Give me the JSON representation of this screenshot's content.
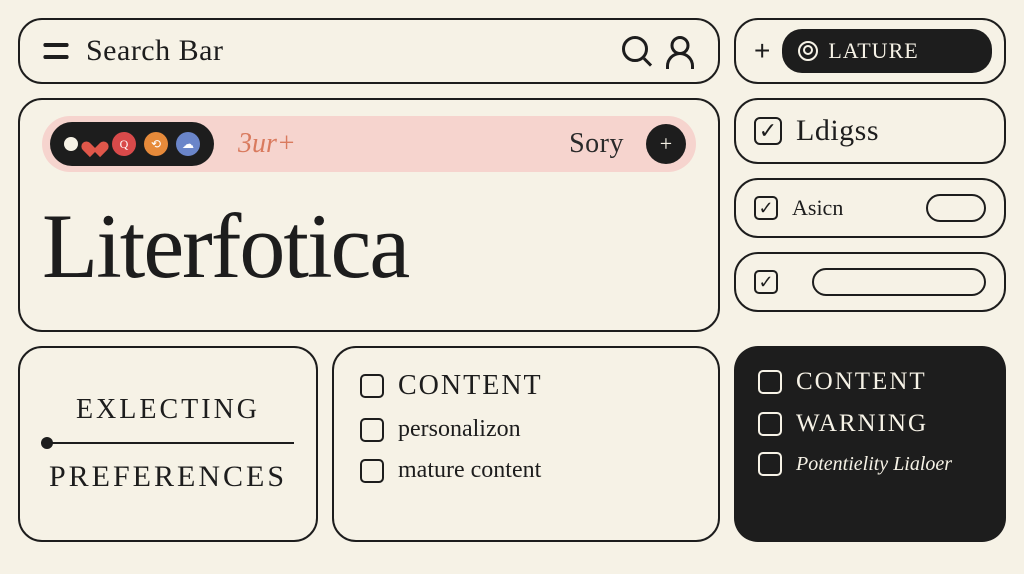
{
  "search": {
    "placeholder": "Search Bar"
  },
  "topRight": {
    "plus": "+",
    "pill": "LATURE"
  },
  "hero": {
    "tabLabel1": "3ur+",
    "tabLabel2": "Sory",
    "title": "Literfotica"
  },
  "right": {
    "ldigss": "Ldigss",
    "asicn": "Asicn",
    "blank": ""
  },
  "prefs": {
    "line1": "EXLECTING",
    "line2": "PREFERENCES"
  },
  "content": {
    "heading": "CONTENT",
    "item1": "personalizon",
    "item2": "mature content"
  },
  "warn": {
    "line1": "CONTENT",
    "line2": "WARNING",
    "line3": "Potentielity Lialoer"
  }
}
